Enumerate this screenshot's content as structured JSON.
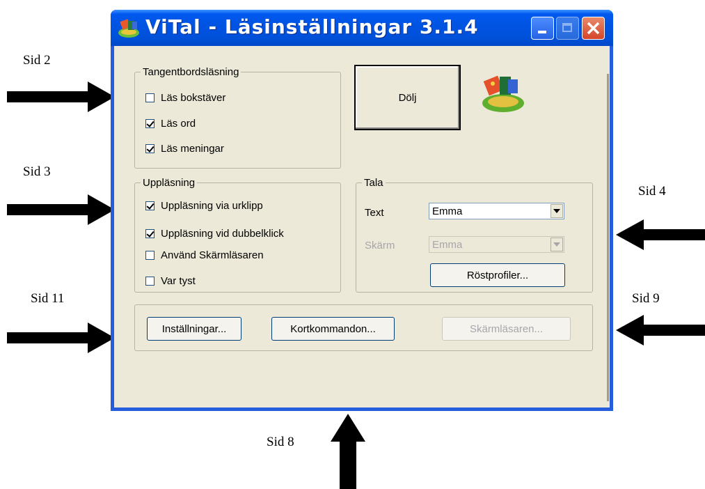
{
  "annotations": {
    "sid2": "Sid 2",
    "sid3": "Sid 3",
    "sid4": "Sid 4",
    "sid11": "Sid 11",
    "sid9": "Sid 9",
    "sid8": "Sid 8"
  },
  "window": {
    "title": "ViTal - Läsinställningar 3.1.4",
    "icon": "vital-app-icon",
    "controls": [
      "minimize-icon",
      "maximize-icon",
      "close-icon"
    ]
  },
  "keyboard_group": {
    "title": "Tangentbordsläsning",
    "items": [
      {
        "label": "Läs bokstäver",
        "checked": false
      },
      {
        "label": "Läs ord",
        "checked": true
      },
      {
        "label": "Läs meningar",
        "checked": true
      }
    ]
  },
  "hide_button": "Dölj",
  "reading_group": {
    "title": "Uppläsning",
    "items": [
      {
        "label": "Uppläsning via urklipp",
        "checked": true
      },
      {
        "label": "Uppläsning vid dubbelklick",
        "checked": true
      },
      {
        "label": "Använd Skärmläsaren",
        "checked": false
      },
      {
        "label": "Var tyst",
        "checked": false
      }
    ]
  },
  "speak_group": {
    "title": "Tala",
    "text_label": "Text",
    "text_value": "Emma",
    "screen_label": "Skärm",
    "screen_value": "Emma",
    "voice_profiles_button": "Röstprofiler..."
  },
  "bottom_buttons": {
    "settings": "Inställningar...",
    "shortcuts": "Kortkommandon...",
    "screen_reader": "Skärmläsaren..."
  },
  "colors": {
    "titlebar": "#0054e3",
    "client": "#ece9d8",
    "close_button": "#d6452a"
  }
}
